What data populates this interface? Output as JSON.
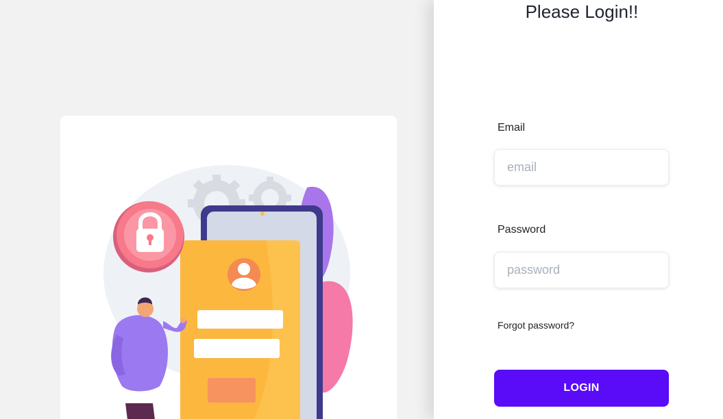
{
  "login": {
    "title": "Please Login!!",
    "email_label": "Email",
    "email_placeholder": "email",
    "email_value": "",
    "password_label": "Password",
    "password_placeholder": "password",
    "password_value": "",
    "forgot_password_label": "Forgot password?",
    "login_button_label": "LOGIN"
  },
  "colors": {
    "page_background": "#f2f2f2",
    "panel_background": "#ffffff",
    "button_accent": "#5a0bf7",
    "phone_screen": "#fcb73e",
    "lock_badge": "#f7798a",
    "figure_shirt": "#9b79f0"
  },
  "illustration": {
    "icons": [
      "lock-icon",
      "user-avatar-icon",
      "gear-icon"
    ]
  }
}
